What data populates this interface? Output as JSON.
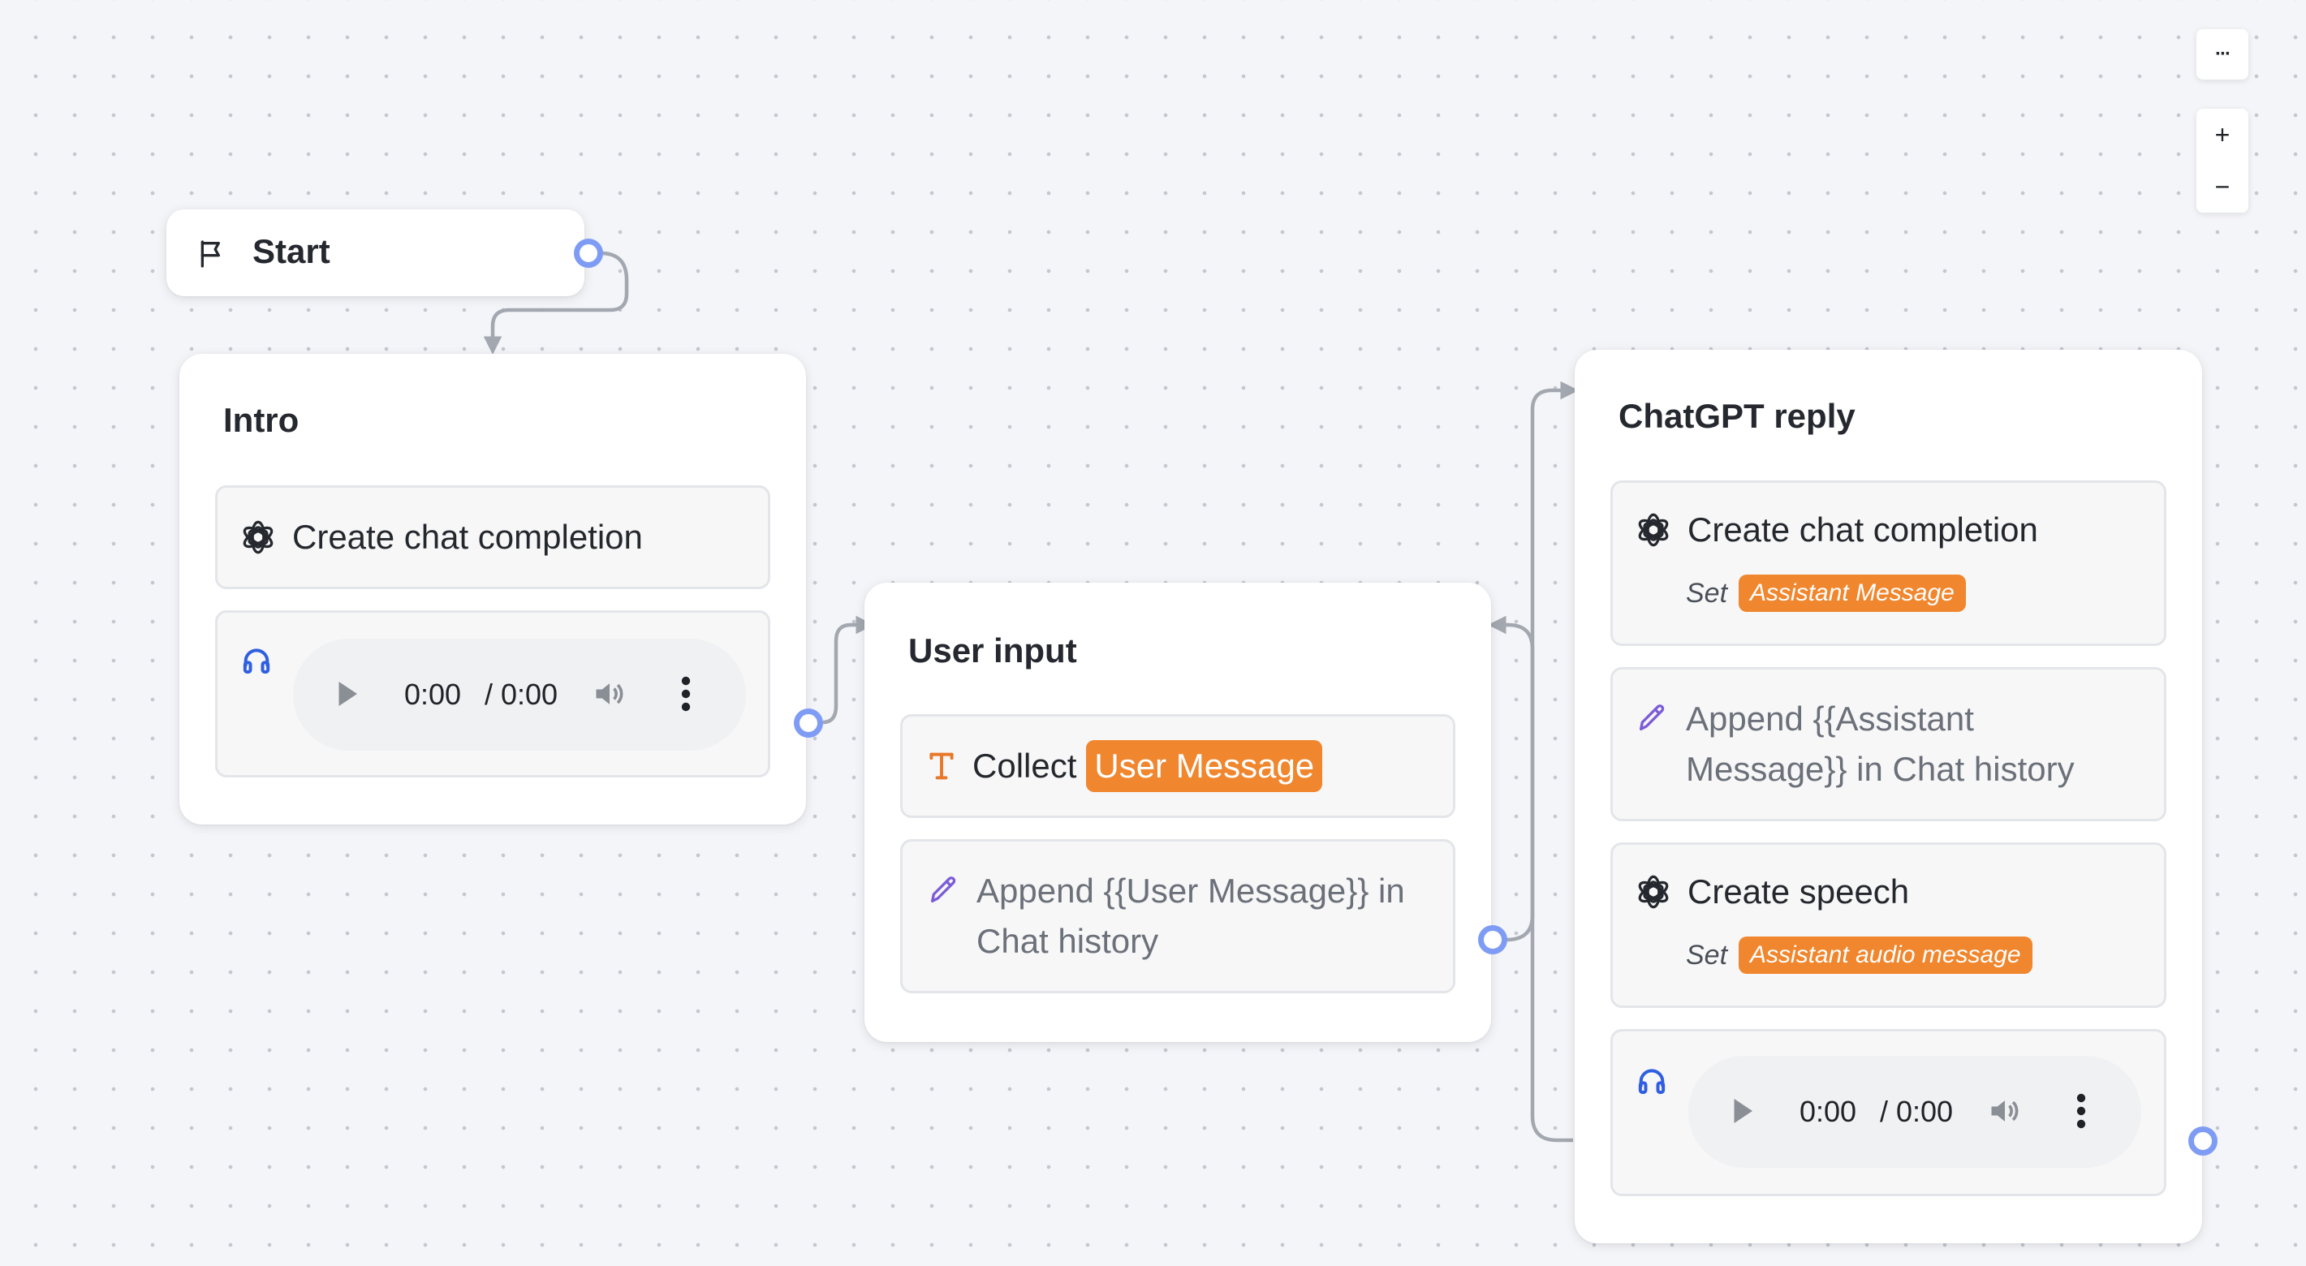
{
  "start_node": {
    "label": "Start",
    "icon": "flag-icon"
  },
  "groups": {
    "intro": {
      "title": "Intro",
      "blocks": {
        "completion": {
          "label": "Create chat completion",
          "icon": "openai-icon"
        },
        "audio": {
          "icon": "headphones-icon",
          "current_time": "0:00",
          "duration": "/ 0:00"
        }
      }
    },
    "user_input": {
      "title": "User input",
      "blocks": {
        "collect": {
          "prefix": "Collect",
          "variable": "User Message",
          "icon": "text-input-icon"
        },
        "append": {
          "line1": "Append {{User Message}} in",
          "line2": "Chat history",
          "icon": "pencil-icon"
        }
      }
    },
    "chatgpt_reply": {
      "title": "ChatGPT reply",
      "blocks": {
        "completion": {
          "label": "Create chat completion",
          "set_label": "Set",
          "variable": "Assistant Message",
          "icon": "openai-icon"
        },
        "append": {
          "line1": "Append {{Assistant",
          "line2": "Message}} in Chat history",
          "icon": "pencil-icon"
        },
        "speech": {
          "label": "Create speech",
          "set_label": "Set",
          "variable": "Assistant audio message",
          "icon": "openai-icon"
        },
        "audio": {
          "icon": "headphones-icon",
          "current_time": "0:00",
          "duration": "/ 0:00"
        }
      }
    }
  },
  "controls": {
    "more": "···",
    "zoom_in": "+",
    "zoom_out": "−"
  },
  "colors": {
    "canvas": "#f4f5f8",
    "accent_handle": "#7f9cf5",
    "variable_pill": "#f0862d",
    "edge": "#a3a7af",
    "pencil": "#7b5cd6",
    "headphones": "#2f5fe0"
  }
}
